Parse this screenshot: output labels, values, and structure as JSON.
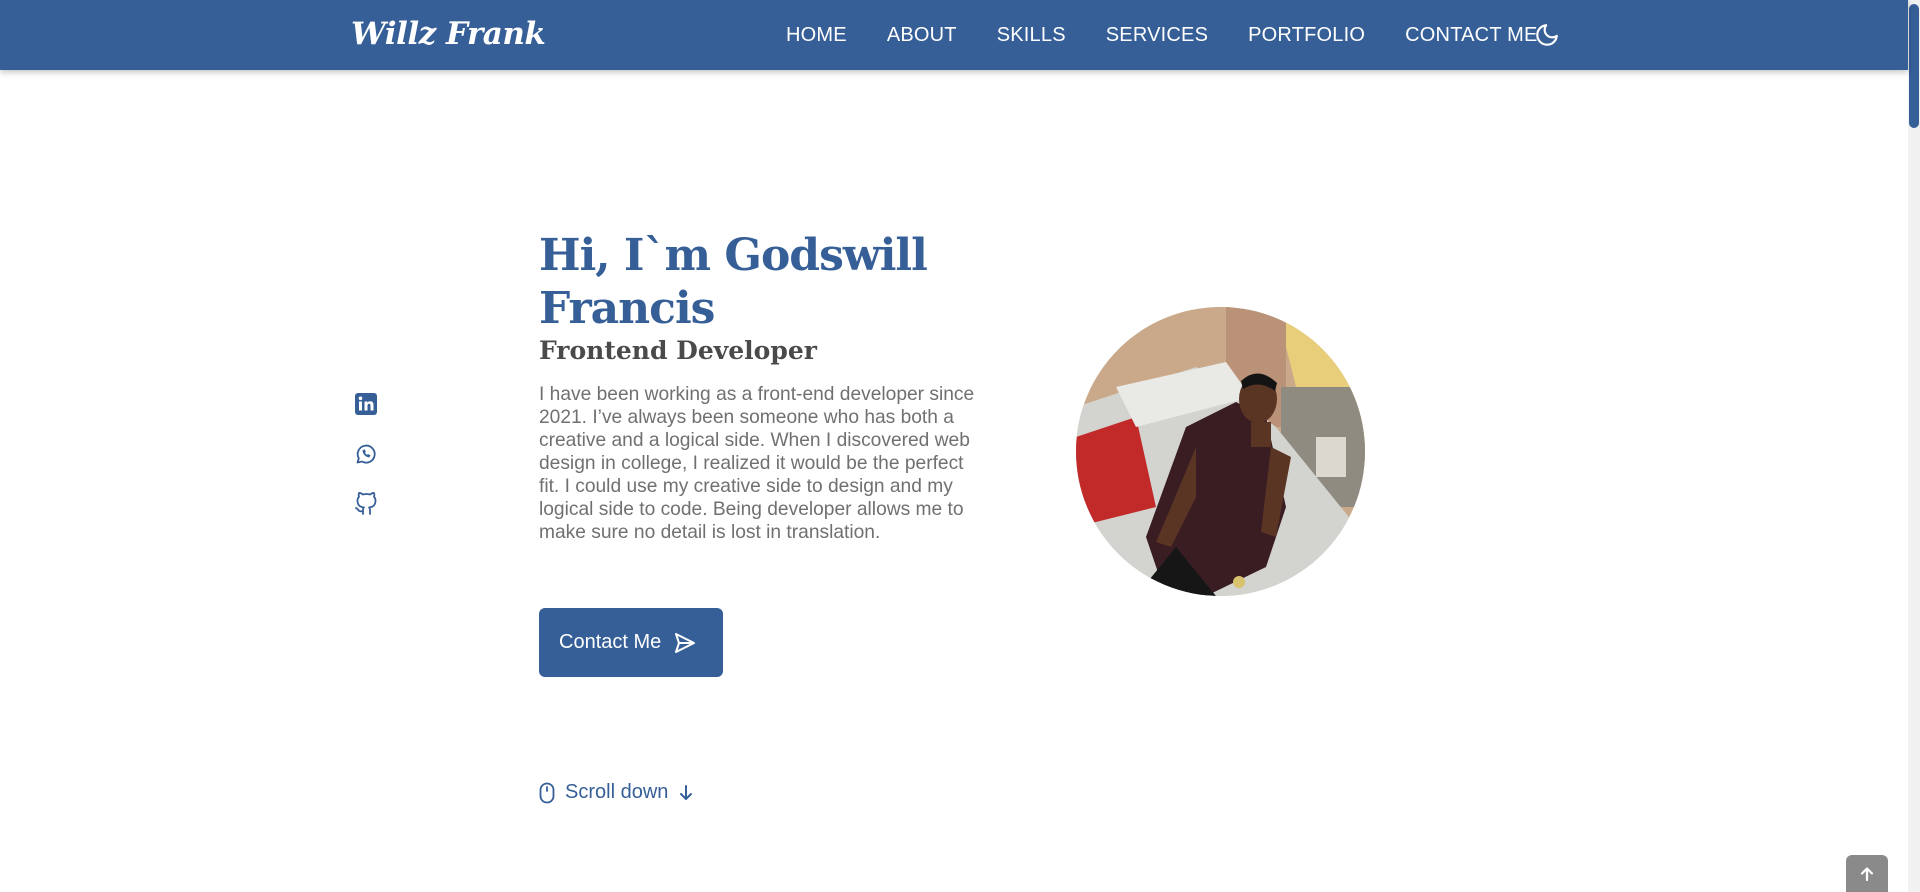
{
  "header": {
    "logo": "Willz Frank",
    "nav": [
      {
        "label": "HOME"
      },
      {
        "label": "ABOUT"
      },
      {
        "label": "SKILLS"
      },
      {
        "label": "SERVICES"
      },
      {
        "label": "PORTFOLIO"
      },
      {
        "label": "CONTACT ME"
      }
    ],
    "theme_icon": "moon-icon"
  },
  "hero": {
    "title": "Hi, I`m Godswill Francis",
    "subtitle": "Frontend Developer",
    "description": "I have been working as a front-end developer since 2021. I’ve always been someone who has both a creative and a logical side. When I discovered web design in college, I realized it would be the perfect fit. I could use my creative side to design and my logical side to code. Being developer allows me to make sure no detail is lost in translation.",
    "contact_button": "Contact Me",
    "scroll_down": "Scroll down"
  },
  "social": [
    {
      "icon": "linkedin-icon"
    },
    {
      "icon": "whatsapp-icon"
    },
    {
      "icon": "github-icon"
    }
  ],
  "colors": {
    "primary": "#365f98",
    "text": "#707070",
    "heading": "#4a4a4a",
    "back_to_top": "#8a8a8a"
  }
}
